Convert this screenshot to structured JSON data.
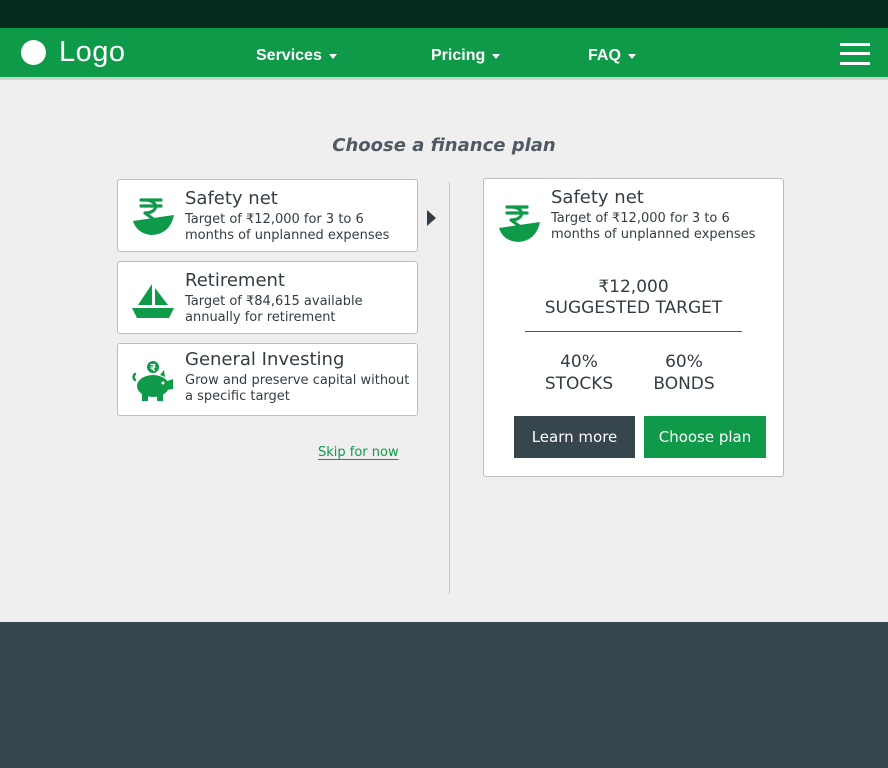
{
  "brand": {
    "logo_text": "Logo"
  },
  "nav": {
    "items": [
      {
        "label": "Services"
      },
      {
        "label": "Pricing"
      },
      {
        "label": "FAQ"
      }
    ],
    "menu_icon": "hamburger-icon"
  },
  "heading": "Choose a finance plan",
  "plans": [
    {
      "title": "Safety net",
      "description": "Target of ₹12,000 for 3 to 6 months of unplanned expenses",
      "icon": "rupee-bowl-icon"
    },
    {
      "title": "Retirement",
      "description": "Target of ₹84,615 available annually for retirement",
      "icon": "sailboat-icon"
    },
    {
      "title": "General Investing",
      "description": "Grow and preserve capital without a specific target",
      "icon": "piggy-bank-icon"
    }
  ],
  "skip_label": "Skip for now",
  "selected_index": 0,
  "detail": {
    "title": "Safety net",
    "description": "Target of ₹12,000 for 3 to 6 months of unplanned expenses",
    "target_amount": "₹12,000",
    "target_label": "SUGGESTED TARGET",
    "allocations": [
      {
        "percent": "40%",
        "asset": "STOCKS"
      },
      {
        "percent": "60%",
        "asset": "BONDS"
      }
    ],
    "learn_more_label": "Learn more",
    "choose_plan_label": "Choose plan"
  },
  "colors": {
    "brand_green": "#0e9a49",
    "top_strip": "#052b1e",
    "dark_slate": "#37454c",
    "page_bg": "#efefef"
  }
}
